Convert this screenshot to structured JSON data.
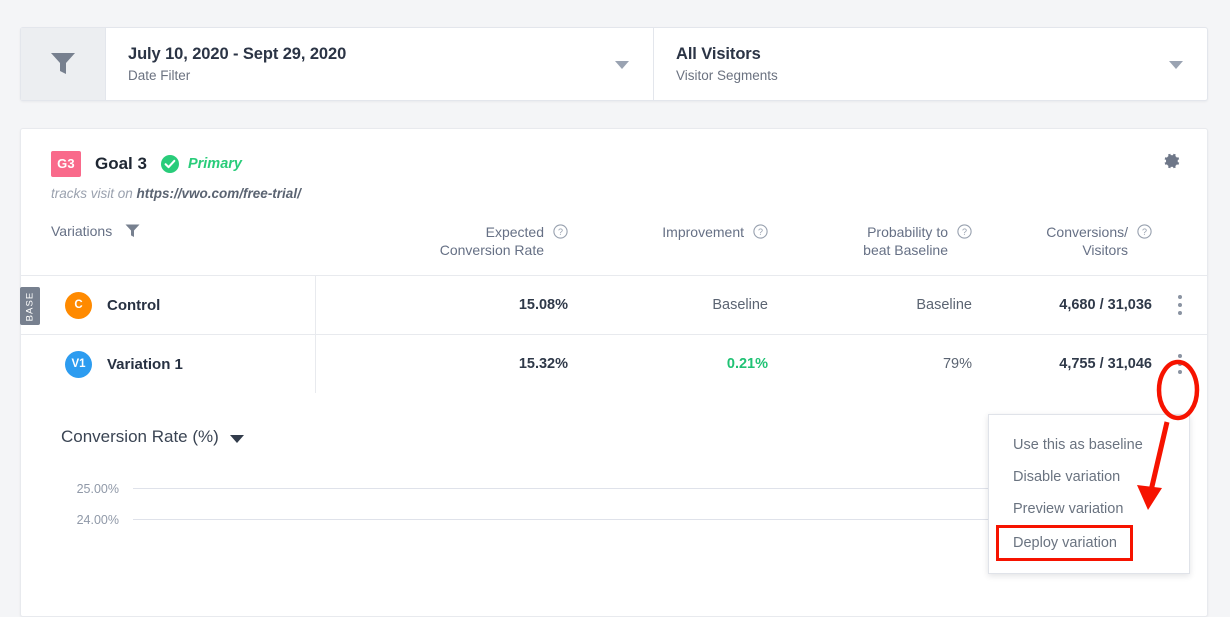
{
  "filter_bar": {
    "funnel_icon": "filter-funnel-icon",
    "date": {
      "value": "July 10, 2020 - Sept 29, 2020",
      "label": "Date Filter"
    },
    "segment": {
      "value": "All Visitors",
      "label": "Visitor Segments"
    }
  },
  "goal": {
    "badge": "G3",
    "title": "Goal 3",
    "primary_label": "Primary",
    "tracks_prefix": "tracks visit on",
    "url": "https://vwo.com/free-trial/",
    "settings_icon": "gear-icon"
  },
  "table": {
    "headers": {
      "variations": "Variations",
      "expected_conversion_rate_l1": "Expected",
      "expected_conversion_rate_l2": "Conversion Rate",
      "improvement": "Improvement",
      "probability_l1": "Probability to",
      "probability_l2": "beat Baseline",
      "conversions_l1": "Conversions/",
      "conversions_l2": "Visitors"
    },
    "rows": [
      {
        "badge": "BASE",
        "initials": "C",
        "name": "Control",
        "expected_conversion_rate": "15.08%",
        "improvement": "Baseline",
        "probability": "Baseline",
        "conversions": "4,680 / 31,036"
      },
      {
        "badge": "",
        "initials": "V1",
        "name": "Variation 1",
        "expected_conversion_rate": "15.32%",
        "improvement": "0.21%",
        "probability": "79%",
        "conversions": "4,755 / 31,046"
      }
    ]
  },
  "menu": {
    "items": [
      "Use this as baseline",
      "Disable variation",
      "Preview variation",
      "Deploy variation"
    ],
    "highlighted_index": 3
  },
  "chart": {
    "title": "Conversion Rate (%)"
  },
  "chart_data": {
    "type": "line",
    "title": "Conversion Rate (%)",
    "xlabel": "",
    "ylabel": "Conversion Rate (%)",
    "ytick_labels": [
      "25.00%",
      "24.00%"
    ],
    "yticks": [
      25.0,
      24.0
    ],
    "grid": true,
    "legend": "none",
    "series": [],
    "note": "Only the top of the chart is visible; y-axis gridlines at 25.00% and 24.00%."
  },
  "colors": {
    "page_bg": "#f4f5f7",
    "goal_badge": "#f96a8b",
    "primary_green": "#29cc7a",
    "improvement_green": "#20c274",
    "control_dot": "#ff8a00",
    "variation_dot": "#2d9cf0",
    "annotation_red": "#f61300"
  }
}
